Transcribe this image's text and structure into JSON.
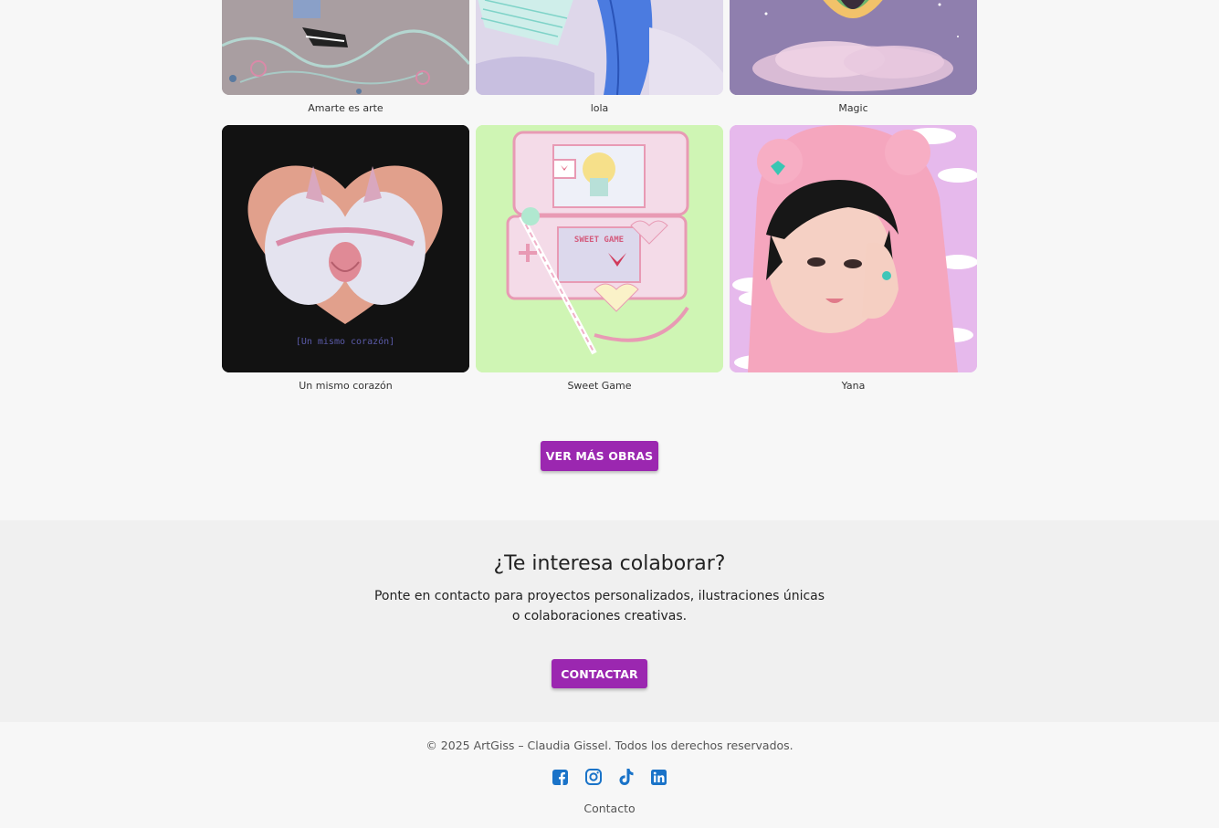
{
  "gallery": {
    "row1": [
      {
        "title": "Amarte es arte"
      },
      {
        "title": "lola"
      },
      {
        "title": "Magic"
      }
    ],
    "row2": [
      {
        "title": "Un mismo corazón",
        "inner_text": "[Un mismo corazón]"
      },
      {
        "title": "Sweet Game",
        "inner_text": "SWEET GAME"
      },
      {
        "title": "Yana"
      }
    ],
    "more_button": "VER MÁS OBRAS"
  },
  "collab": {
    "title": "¿Te interesa colaborar?",
    "text": "Ponte en contacto para proyectos personalizados, ilustraciones únicas o colaboraciones creativas.",
    "button": "CONTACTAR"
  },
  "footer": {
    "copyright": "© 2025 ArtGiss – Claudia Gissel. Todos los derechos reservados.",
    "socials": [
      "facebook-icon",
      "instagram-icon",
      "tiktok-icon",
      "linkedin-icon"
    ],
    "contact_link": "Contacto"
  },
  "colors": {
    "accent": "#9b27b0",
    "social_blue": "#1a73c8",
    "collab_bg": "#f0f0f0",
    "page_bg": "#f7f7f7"
  }
}
